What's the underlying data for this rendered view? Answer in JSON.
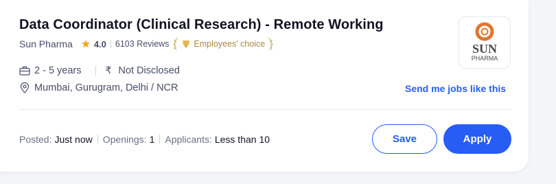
{
  "job": {
    "title": "Data Coordinator (Clinical Research) - Remote Working",
    "company": "Sun Pharma",
    "rating": "4.0",
    "reviews": "6103 Reviews",
    "badge": "Employees' choice",
    "experience": "2 - 5 years",
    "salary": "Not Disclosed",
    "locations": "Mumbai, Gurugram, Delhi / NCR"
  },
  "logo": {
    "line1": "SUN",
    "line2": "PHARMA",
    "colors": {
      "ring": "#e2762f",
      "text": "#4a4a4a"
    }
  },
  "links": {
    "send_jobs": "Send me jobs like this"
  },
  "footer": {
    "posted_label": "Posted:",
    "posted_value": "Just now",
    "openings_label": "Openings:",
    "openings_value": "1",
    "applicants_label": "Applicants:",
    "applicants_value": "Less than 10"
  },
  "actions": {
    "save_label": "Save",
    "apply_label": "Apply"
  },
  "icons": {
    "rating": "star-icon",
    "badge": "laurel-badge-icon",
    "experience": "briefcase-icon",
    "salary": "rupee-icon",
    "location": "location-pin-icon"
  },
  "colors": {
    "accent": "#275df5",
    "star": "#f5a623",
    "badge_gold": "#a88840",
    "title": "#121224",
    "secondary_text": "#474d6a"
  }
}
